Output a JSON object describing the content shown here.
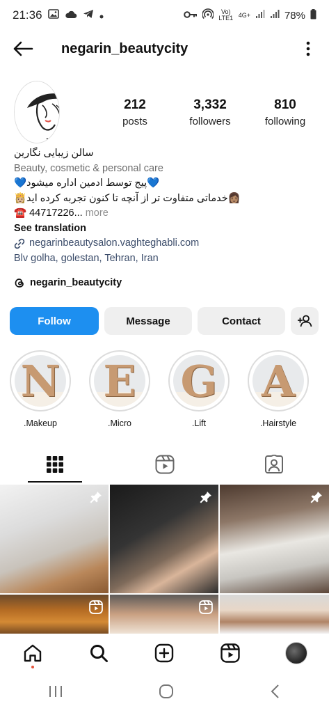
{
  "status_bar": {
    "time": "21:36",
    "carrier_text": "Vo) LTE1",
    "network": "4G+",
    "battery": "78%"
  },
  "header": {
    "username": "negarin_beautycity"
  },
  "stats": {
    "posts_count": "212",
    "posts_label": "posts",
    "followers_count": "3,332",
    "followers_label": "followers",
    "following_count": "810",
    "following_label": "following"
  },
  "bio": {
    "name": "سالن زیبایی نگارین",
    "category": "Beauty, cosmetic & personal care",
    "line1": "💙پیج توسط ادمین اداره میشود💙",
    "line2": "👩🏽خدماتی متفاوت تر از آنچه تا کنون تجربه کرده اید👸🏼",
    "phone": "☎️ 44717226...",
    "more": " more",
    "see_translation": "See translation",
    "link": "negarinbeautysalon.vaghteghabli.com",
    "location": "Blv golha, golestan, Tehran, Iran",
    "threads_handle": "negarin_beautycity"
  },
  "buttons": {
    "follow": "Follow",
    "message": "Message",
    "contact": "Contact"
  },
  "highlights": [
    {
      "letter": "N",
      "label": ".Makeup"
    },
    {
      "letter": "E",
      "label": ".Micro"
    },
    {
      "letter": "G",
      "label": ".Lift"
    },
    {
      "letter": "A",
      "label": ".Hairstyle"
    }
  ],
  "tabs": [
    "grid-icon",
    "reels-icon",
    "tagged-icon"
  ],
  "icons": {
    "pinned": "pin-icon",
    "reel_badge": "reels-icon"
  },
  "colors": {
    "follow_button": "#1d8ff0",
    "secondary_button": "#efefef",
    "link_text": "#3b4c6a"
  }
}
